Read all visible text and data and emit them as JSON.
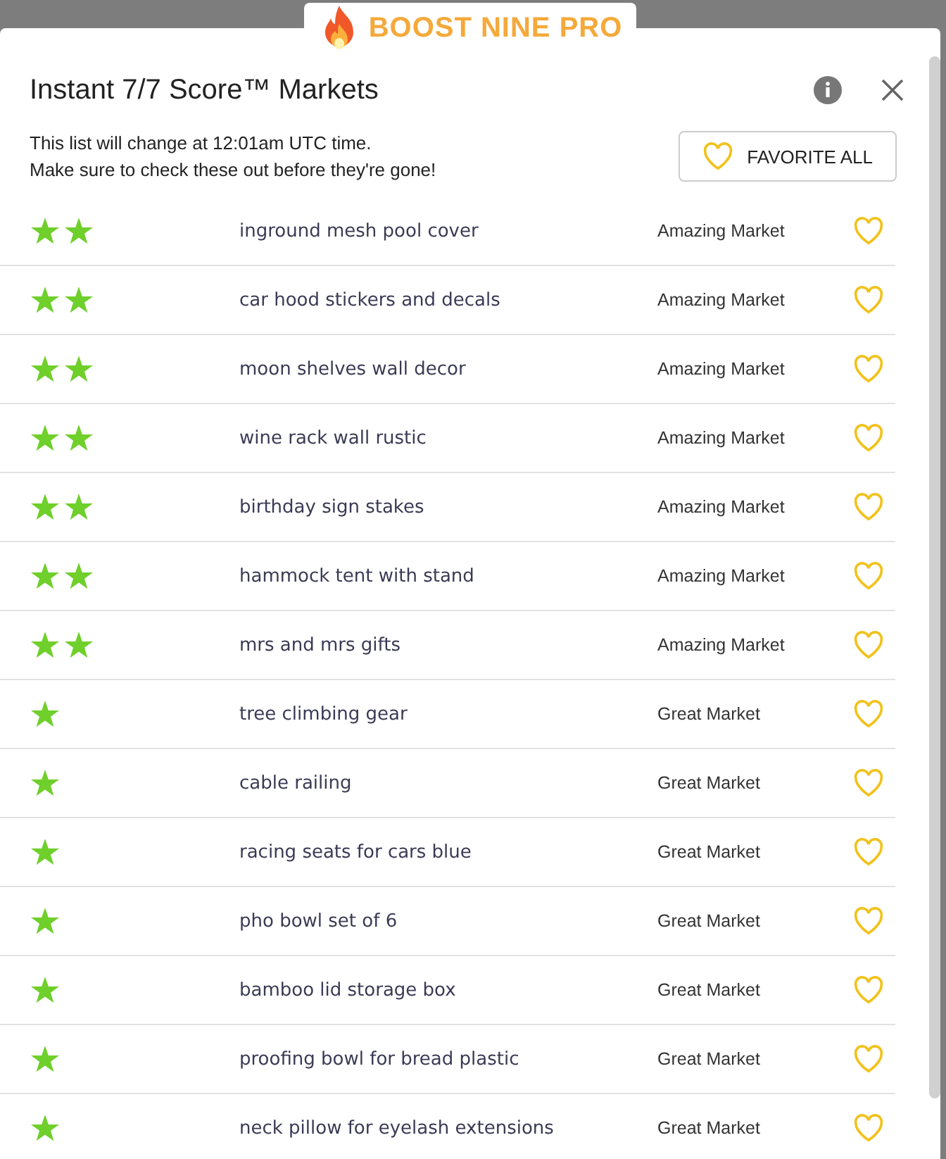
{
  "logo": {
    "text": "BOOST NINE PRO"
  },
  "dialog": {
    "title": "Instant 7/7 Score™ Markets",
    "notice": [
      "This list will change at 12:01am UTC time.",
      "Make sure to check these out before they're gone!"
    ],
    "favorite_all": "FAVORITE ALL"
  },
  "rows": [
    {
      "kind": "two-star",
      "keyword": "inground mesh pool cover",
      "market": "Amazing Market",
      "favorited": false
    },
    {
      "kind": "two-star",
      "keyword": "car hood stickers and decals",
      "market": "Amazing Market",
      "favorited": false
    },
    {
      "kind": "two-star",
      "keyword": "moon shelves wall decor",
      "market": "Amazing Market",
      "favorited": false
    },
    {
      "kind": "two-star",
      "keyword": "wine rack wall rustic",
      "market": "Amazing Market",
      "favorited": false
    },
    {
      "kind": "two-star",
      "keyword": "birthday sign stakes",
      "market": "Amazing Market",
      "favorited": false
    },
    {
      "kind": "two-star",
      "keyword": "hammock tent with stand",
      "market": "Amazing Market",
      "favorited": false
    },
    {
      "kind": "two-star",
      "keyword": "mrs and mrs gifts",
      "market": "Amazing Market",
      "favorited": false
    },
    {
      "kind": "one-star",
      "keyword": "tree climbing gear",
      "market": "Great Market",
      "favorited": false
    },
    {
      "kind": "one-star",
      "keyword": "cable railing",
      "market": "Great Market",
      "favorited": false
    },
    {
      "kind": "one-star",
      "keyword": "racing seats for cars blue",
      "market": "Great Market",
      "favorited": false
    },
    {
      "kind": "one-star",
      "keyword": "pho bowl set of 6",
      "market": "Great Market",
      "favorited": false
    },
    {
      "kind": "one-star",
      "keyword": "bamboo lid storage box",
      "market": "Great Market",
      "favorited": false
    },
    {
      "kind": "one-star",
      "keyword": "proofing bowl for bread plastic",
      "market": "Great Market",
      "favorited": false
    },
    {
      "kind": "one-star",
      "keyword": "neck pillow for eyelash extensions",
      "market": "Great Market",
      "favorited": false
    }
  ]
}
